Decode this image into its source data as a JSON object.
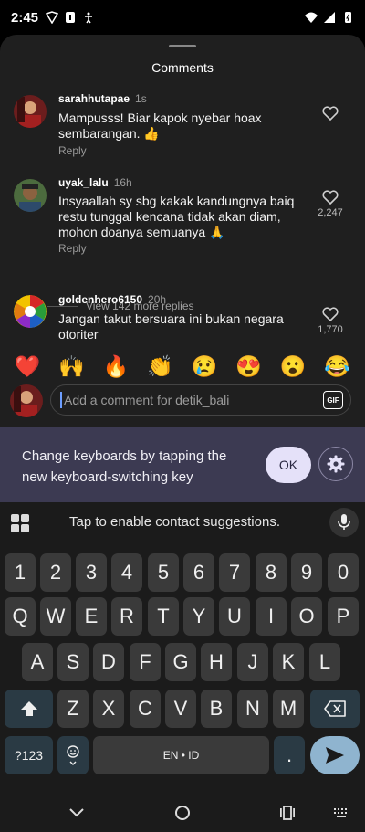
{
  "status_bar": {
    "time": "2:45",
    "left_icons": [
      "vpn-icon",
      "notification-icon",
      "accessibility-icon"
    ],
    "right_icons": [
      "wifi-icon",
      "signal-icon",
      "battery-icon"
    ]
  },
  "sheet": {
    "title": "Comments"
  },
  "comments": [
    {
      "username": "sarahhutapae",
      "time": "1s",
      "text": "Mampusss! Biar kapok nyebar hoax sembarangan. 👍",
      "reply_label": "Reply",
      "like_count": ""
    },
    {
      "username": "uyak_lalu",
      "time": "16h",
      "text": "Insyaallah sy sbg kakak kandungnya baiq restu tunggal kencana tidak akan diam, mohon doanya semuanya 🙏",
      "reply_label": "Reply",
      "like_count": "2,247"
    },
    {
      "username": "goldenhero6150",
      "time": "20h",
      "text": "Jangan takut bersuara ini bukan negara otoriter",
      "reply_label": "",
      "like_count": "1,770"
    }
  ],
  "view_more_replies": "View 142 more replies",
  "emoji_bar": [
    "❤️",
    "🙌",
    "🔥",
    "👏",
    "😢",
    "😍",
    "😮",
    "😂"
  ],
  "comment_input": {
    "placeholder": "Add a comment for detik_bali",
    "gif_label": "GIF"
  },
  "keyboard_banner": {
    "text": "Change keyboards by tapping the new keyboard-switching key",
    "ok_label": "OK"
  },
  "keyboard": {
    "suggestion_text": "Tap to enable contact suggestions.",
    "number_row": [
      "1",
      "2",
      "3",
      "4",
      "5",
      "6",
      "7",
      "8",
      "9",
      "0"
    ],
    "row1": [
      "Q",
      "W",
      "E",
      "R",
      "T",
      "Y",
      "U",
      "I",
      "O",
      "P"
    ],
    "row2": [
      "A",
      "S",
      "D",
      "F",
      "G",
      "H",
      "J",
      "K",
      "L"
    ],
    "row3": [
      "Z",
      "X",
      "C",
      "V",
      "B",
      "N",
      "M"
    ],
    "symbols_label": "?123",
    "space_label": "EN • ID",
    "period_label": "."
  },
  "colors": {
    "sheet_bg": "#1f1f1f",
    "banner_bg": "#3c3a52",
    "key_bg": "#3a3a3a",
    "accent_key": "#8fb4cf"
  }
}
